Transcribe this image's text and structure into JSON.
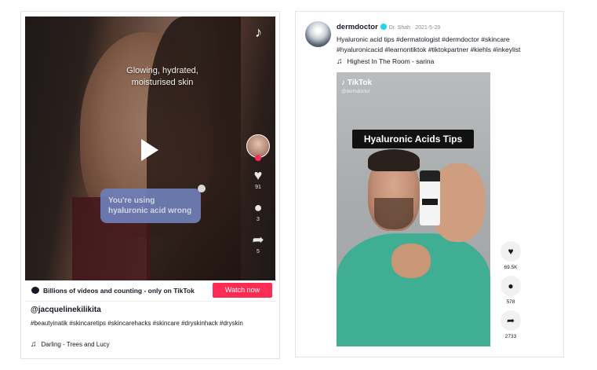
{
  "left_card": {
    "overlay_caption": "Glowing, hydrated, moisturised skin",
    "bubble_text": "You're using hyaluronic acid wrong",
    "rail": {
      "likes": "91",
      "comments": "3",
      "shares": "5"
    },
    "watch_bar": {
      "text": "Billions of videos and counting - only on TikTok",
      "button": "Watch now"
    },
    "username": "@jacquelinekilikita",
    "hashtags": "#beautyinatik #skincaretips #skincarehacks #skincare #dryskinhack #dryskin",
    "music": "Darling - Trees and Lucy",
    "colors": {
      "button": "#fe2c55"
    }
  },
  "right_card": {
    "username": "dermdoctor",
    "meta": "Dr. Shah · 2021-5-29",
    "caption": "Hyaluronic acid tips #dermatologist #dermdoctor #skincare #hyaluronicacid #learnontiktok #tiktokpartner #kiehls #inkeylist",
    "music": "Highest In The Room - sarina",
    "video": {
      "brand": "TikTok",
      "handle": "@dermdoctor",
      "title": "Hyaluronic Acids Tips"
    },
    "rail": {
      "likes": "69.5K",
      "comments": "578",
      "shares": "2733"
    },
    "colors": {
      "verified": "#20d5ec",
      "shirt": "#3fae93"
    }
  }
}
